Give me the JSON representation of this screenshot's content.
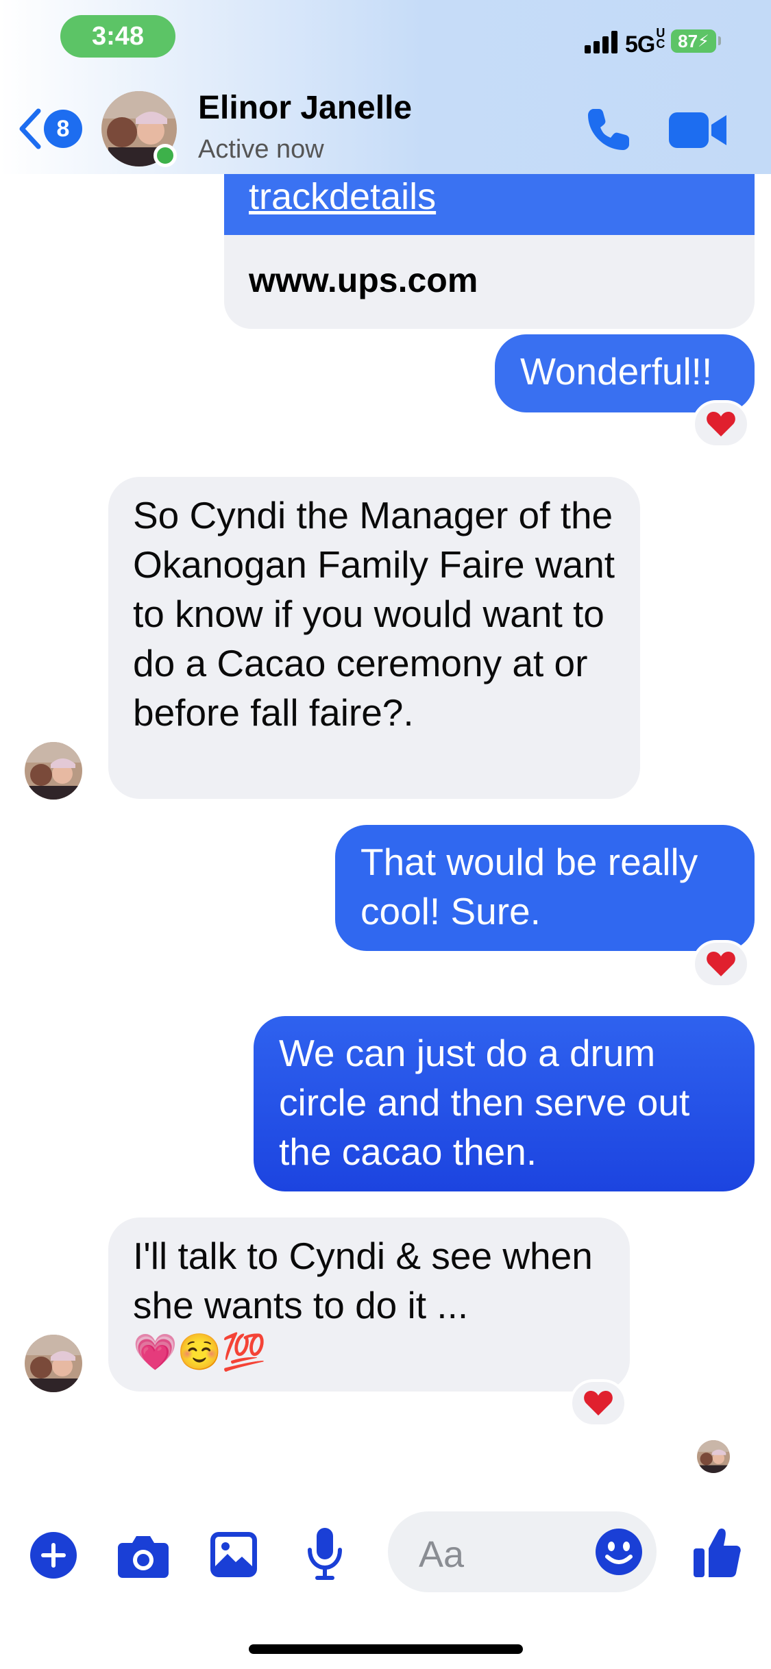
{
  "status_bar": {
    "time": "3:48",
    "network": "5GUC",
    "battery": "87"
  },
  "header": {
    "back_count": "8",
    "contact_name": "Elinor Janelle",
    "contact_status": "Active now",
    "accent_color": "#1d6df0"
  },
  "link_preview": {
    "link_text": "trackdetails",
    "domain": "www.ups.com"
  },
  "messages": [
    {
      "from": "me",
      "text": "Wonderful!!",
      "reaction": "heart"
    },
    {
      "from": "them",
      "text": "So Cyndi the Manager of the Okanogan Family Faire want to know if you would want to do a Cacao ceremony at or before fall faire?."
    },
    {
      "from": "me",
      "text": "That would be really cool! Sure.",
      "reaction": "heart"
    },
    {
      "from": "me",
      "text": "We can just do a drum circle and then serve out the cacao then."
    },
    {
      "from": "them",
      "text": "I'll talk to Cyndi & see when she wants to do it ...",
      "emojis": "💗☺️💯",
      "reaction": "heart"
    }
  ],
  "composer": {
    "placeholder": "Aa",
    "icons": [
      "plus-icon",
      "camera-icon",
      "photo-icon",
      "microphone-icon",
      "smiley-icon",
      "thumbs-up-icon"
    ]
  }
}
